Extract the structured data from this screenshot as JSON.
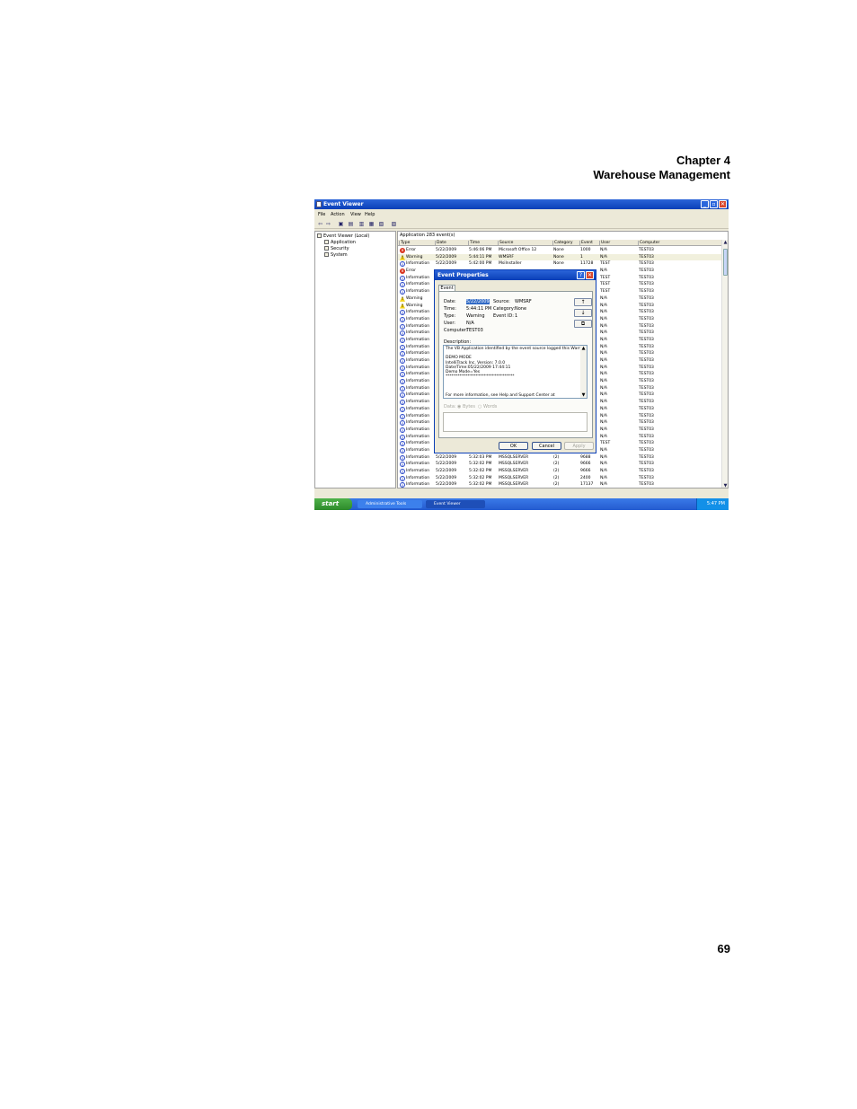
{
  "header": {
    "chapter": "Chapter 4",
    "section": "Warehouse Management"
  },
  "page_number": "69",
  "window": {
    "title": "Event Viewer",
    "menu": [
      "File",
      "Action",
      "View",
      "Help"
    ]
  },
  "tree": {
    "root": "Event Viewer (Local)",
    "items": [
      "Application",
      "Security",
      "System"
    ]
  },
  "list": {
    "info": "Application   283 event(s)",
    "columns": [
      "Type",
      "Date",
      "Time",
      "Source",
      "Category",
      "Event",
      "User",
      "Computer"
    ],
    "rows": [
      {
        "type": "Error",
        "icon": "error",
        "date": "5/22/2009",
        "time": "5:46:06 PM",
        "source": "Microsoft Office 12",
        "category": "None",
        "event": "1000",
        "user": "N/A",
        "computer": "TEST03"
      },
      {
        "type": "Warning",
        "icon": "warning",
        "date": "5/22/2009",
        "time": "5:44:11 PM",
        "source": "WMSRF",
        "category": "None",
        "event": "1",
        "user": "N/A",
        "computer": "TEST03"
      },
      {
        "type": "Information",
        "icon": "info",
        "date": "5/22/2009",
        "time": "5:42:00 PM",
        "source": "MsiInstaller",
        "category": "None",
        "event": "11728",
        "user": "TEST",
        "computer": "TEST03"
      },
      {
        "type": "Error",
        "icon": "error",
        "user": "N/A",
        "computer": "TEST03"
      },
      {
        "type": "Information",
        "icon": "info",
        "user": "TEST",
        "computer": "TEST03"
      },
      {
        "type": "Information",
        "icon": "info",
        "user": "TEST",
        "computer": "TEST03"
      },
      {
        "type": "Information",
        "icon": "info",
        "user": "TEST",
        "computer": "TEST03"
      },
      {
        "type": "Warning",
        "icon": "warning",
        "user": "N/A",
        "computer": "TEST03"
      },
      {
        "type": "Warning",
        "icon": "warning",
        "user": "N/A",
        "computer": "TEST03"
      },
      {
        "type": "Information",
        "icon": "info",
        "user": "N/A",
        "computer": "TEST03"
      },
      {
        "type": "Information",
        "icon": "info",
        "user": "N/A",
        "computer": "TEST03"
      },
      {
        "type": "Information",
        "icon": "info",
        "user": "N/A",
        "computer": "TEST03"
      },
      {
        "type": "Information",
        "icon": "info",
        "user": "N/A",
        "computer": "TEST03"
      },
      {
        "type": "Information",
        "icon": "info",
        "user": "N/A",
        "computer": "TEST03"
      },
      {
        "type": "Information",
        "icon": "info",
        "user": "N/A",
        "computer": "TEST03"
      },
      {
        "type": "Information",
        "icon": "info",
        "user": "N/A",
        "computer": "TEST03"
      },
      {
        "type": "Information",
        "icon": "info",
        "user": "N/A",
        "computer": "TEST03"
      },
      {
        "type": "Information",
        "icon": "info",
        "user": "N/A",
        "computer": "TEST03"
      },
      {
        "type": "Information",
        "icon": "info",
        "user": "N/A",
        "computer": "TEST03"
      },
      {
        "type": "Information",
        "icon": "info",
        "user": "N/A",
        "computer": "TEST03"
      },
      {
        "type": "Information",
        "icon": "info",
        "user": "N/A",
        "computer": "TEST03"
      },
      {
        "type": "Information",
        "icon": "info",
        "user": "N/A",
        "computer": "TEST03"
      },
      {
        "type": "Information",
        "icon": "info",
        "user": "N/A",
        "computer": "TEST03"
      },
      {
        "type": "Information",
        "icon": "info",
        "user": "N/A",
        "computer": "TEST03"
      },
      {
        "type": "Information",
        "icon": "info",
        "user": "N/A",
        "computer": "TEST03"
      },
      {
        "type": "Information",
        "icon": "info",
        "user": "N/A",
        "computer": "TEST03"
      },
      {
        "type": "Information",
        "icon": "info",
        "user": "N/A",
        "computer": "TEST03"
      },
      {
        "type": "Information",
        "icon": "info",
        "user": "N/A",
        "computer": "TEST03"
      },
      {
        "type": "Information",
        "icon": "info",
        "user": "TEST",
        "computer": "TEST03"
      },
      {
        "type": "Information",
        "icon": "info",
        "user": "N/A",
        "computer": "TEST03"
      },
      {
        "type": "Information",
        "icon": "info",
        "date": "5/22/2009",
        "time": "5:32:03 PM",
        "source": "MSSQLSERVER",
        "category": "(2)",
        "event": "9688",
        "user": "N/A",
        "computer": "TEST03"
      },
      {
        "type": "Information",
        "icon": "info",
        "date": "5/22/2009",
        "time": "5:32:02 PM",
        "source": "MSSQLSERVER",
        "category": "(2)",
        "event": "9666",
        "user": "N/A",
        "computer": "TEST03"
      },
      {
        "type": "Information",
        "icon": "info",
        "date": "5/22/2009",
        "time": "5:32:02 PM",
        "source": "MSSQLSERVER",
        "category": "(2)",
        "event": "9666",
        "user": "N/A",
        "computer": "TEST03"
      },
      {
        "type": "Information",
        "icon": "info",
        "date": "5/22/2009",
        "time": "5:32:02 PM",
        "source": "MSSQLSERVER",
        "category": "(2)",
        "event": "2400",
        "user": "N/A",
        "computer": "TEST03"
      },
      {
        "type": "Information",
        "icon": "info",
        "date": "5/22/2009",
        "time": "5:32:02 PM",
        "source": "MSSQLSERVER",
        "category": "(2)",
        "event": "17137",
        "user": "N/A",
        "computer": "TEST03"
      }
    ]
  },
  "dialog": {
    "title": "Event Properties",
    "tab": "Event",
    "date_label": "Date:",
    "date_value": "5/22/2009",
    "source_label": "Source:",
    "source_value": "WMSRF",
    "time_label": "Time:",
    "time_value": "5:44:11 PM",
    "category_label": "Category:",
    "category_value": "None",
    "type_label": "Type:",
    "type_value": "Warning",
    "eventid_label": "Event ID:",
    "eventid_value": "1",
    "user_label": "User:",
    "user_value": "N/A",
    "computer_label": "Computer:",
    "computer_value": "TEST03",
    "description_label": "Description:",
    "description_lines": [
      "The VB Application identified by the event source logged this Warning:",
      "",
      "DEMO MODE",
      "IntelliTrack Inc. Version: 7.0.0",
      "Date/Time:05/22/2009 17:44:11",
      "Demo Mode=Yes",
      "**********************************",
      "",
      "",
      "",
      "For more information, see Help and Support Center at"
    ],
    "data_label": "Data:",
    "bytes_label": "Bytes",
    "words_label": "Words",
    "ok": "OK",
    "cancel": "Cancel",
    "apply": "Apply"
  },
  "taskbar": {
    "start": "start",
    "tasks": [
      "Administrative Tools",
      "Event Viewer"
    ],
    "clock": "5:47 PM"
  },
  "colors": {
    "titlebar": "#0a3fb7",
    "taskbar": "#245bd0",
    "start": "#2c8a2a",
    "error": "#d8341e",
    "warning": "#f2d21a",
    "info": "#2a48c8"
  }
}
